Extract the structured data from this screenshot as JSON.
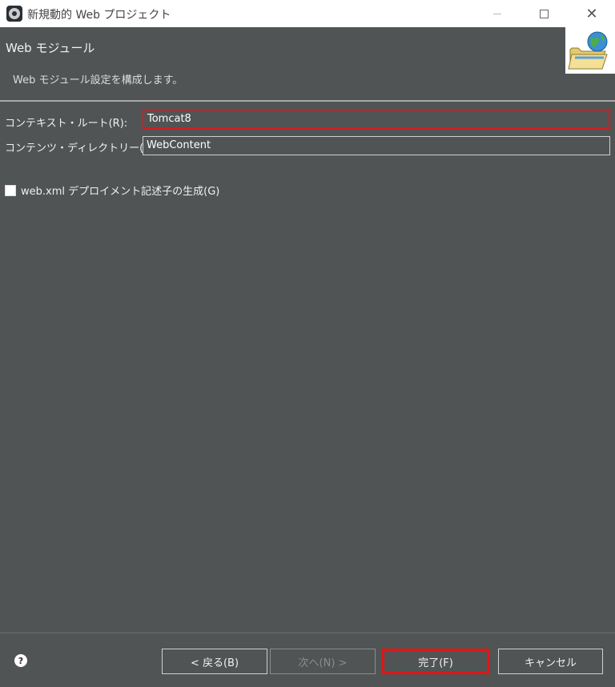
{
  "window": {
    "title": "新規動的 Web プロジェクト",
    "close_glyph": "✕"
  },
  "banner": {
    "title": "Web モジュール",
    "description": "Web モジュール設定を構成します。"
  },
  "form": {
    "context_root_label": "コンテキスト・ルート(R):",
    "context_root_value": "Tomcat8",
    "content_dir_label": "コンテンツ・ディレクトリー(D):",
    "content_dir_value": "WebContent",
    "web_xml_label": "web.xml デプロイメント記述子の生成(G)",
    "web_xml_checked": false
  },
  "footer": {
    "help_glyph": "?",
    "back_label": "< 戻る(B)",
    "next_label": "次へ(N) >",
    "finish_label": "完了(F)",
    "cancel_label": "キャンセル"
  },
  "colors": {
    "background": "#505455",
    "highlight": "#e31414"
  },
  "icons": [
    "app-icon",
    "minimize-icon",
    "maximize-icon",
    "close-icon",
    "folder-globe-icon",
    "help-icon"
  ]
}
